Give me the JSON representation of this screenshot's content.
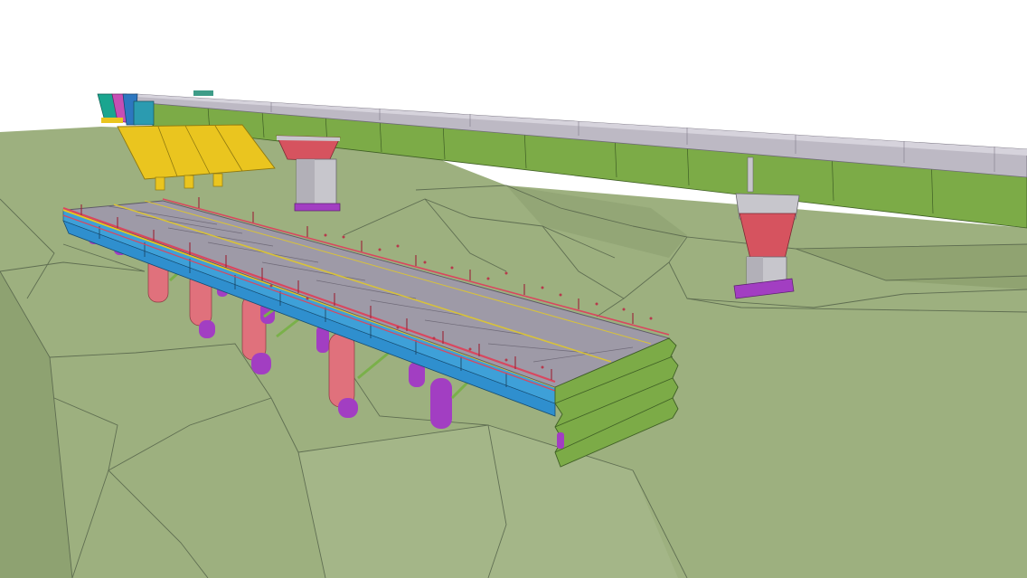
{
  "scene": {
    "colors": {
      "sky": "#ffffff",
      "terrain": "#9db07f",
      "terrain_light": "#a9ba8d",
      "terrain_dark": "#889c6a",
      "terrain_line": "#4d5a3e",
      "deck_top": "#9e9aa7",
      "deck_edge": "#6f6a78",
      "girder_blue": "#2f8fce",
      "railing_red": "#d9475f",
      "pile_pink": "#e0717c",
      "pile_purple": "#a23ec2",
      "bracing_green": "#7ab04a",
      "girder_green": "#7cab47",
      "pier_grey": "#c7c6cc",
      "pier_red": "#d6535f",
      "formwork_yellow": "#eac51f",
      "abutment_teal": "#1aa58f",
      "abutment_magenta": "#c64fb4",
      "abutment_blue": "#2d77c0"
    }
  }
}
